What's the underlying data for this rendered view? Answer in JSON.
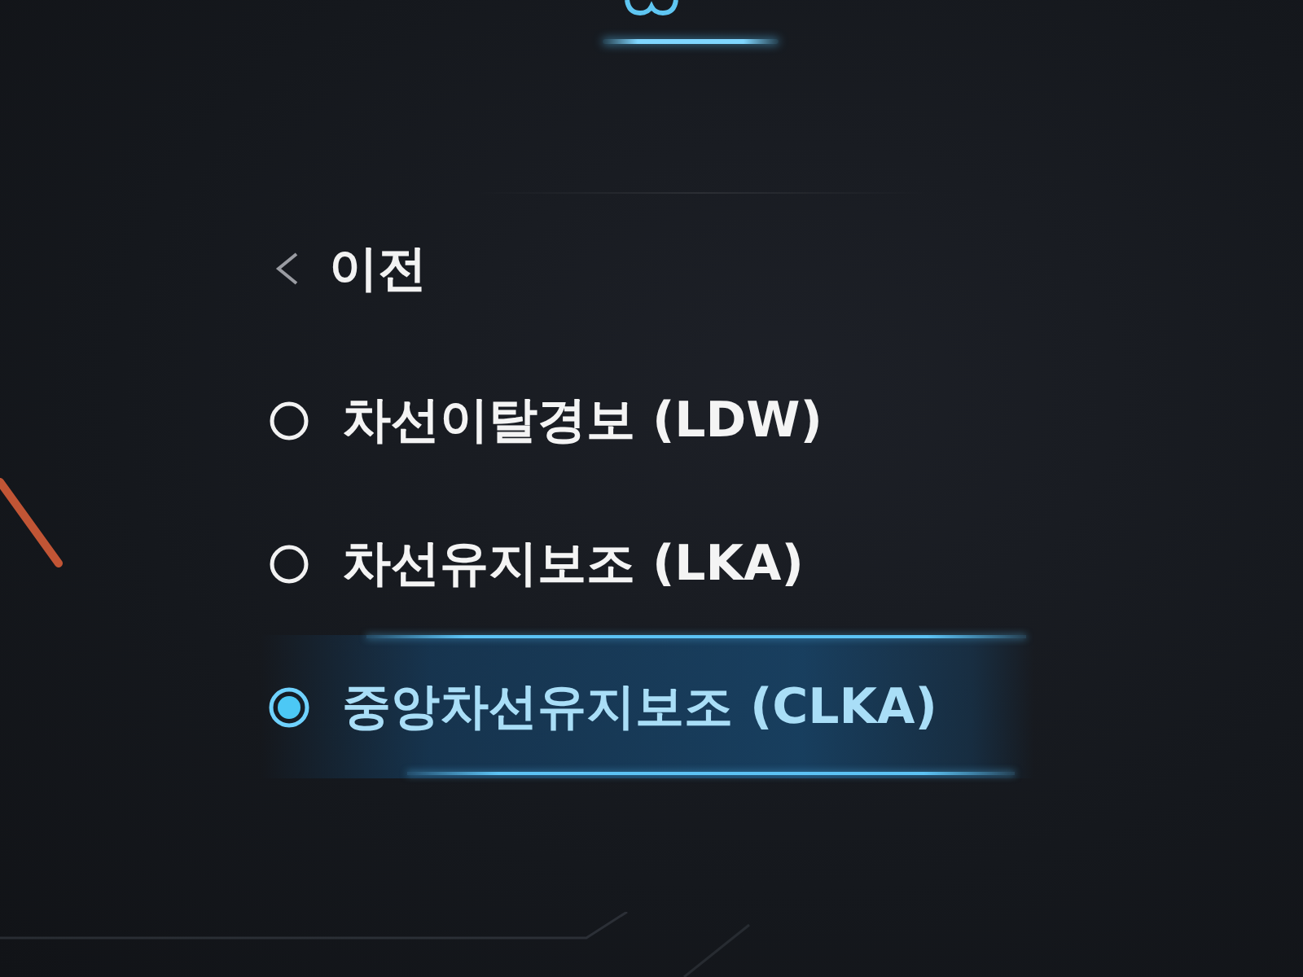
{
  "back": {
    "label": "이전"
  },
  "options": [
    {
      "label": "차선이탈경보 (LDW)",
      "selected": false
    },
    {
      "label": "차선유지보조 (LKA)",
      "selected": false
    },
    {
      "label": "중앙차선유지보조 (CLKA)",
      "selected": true
    }
  ]
}
